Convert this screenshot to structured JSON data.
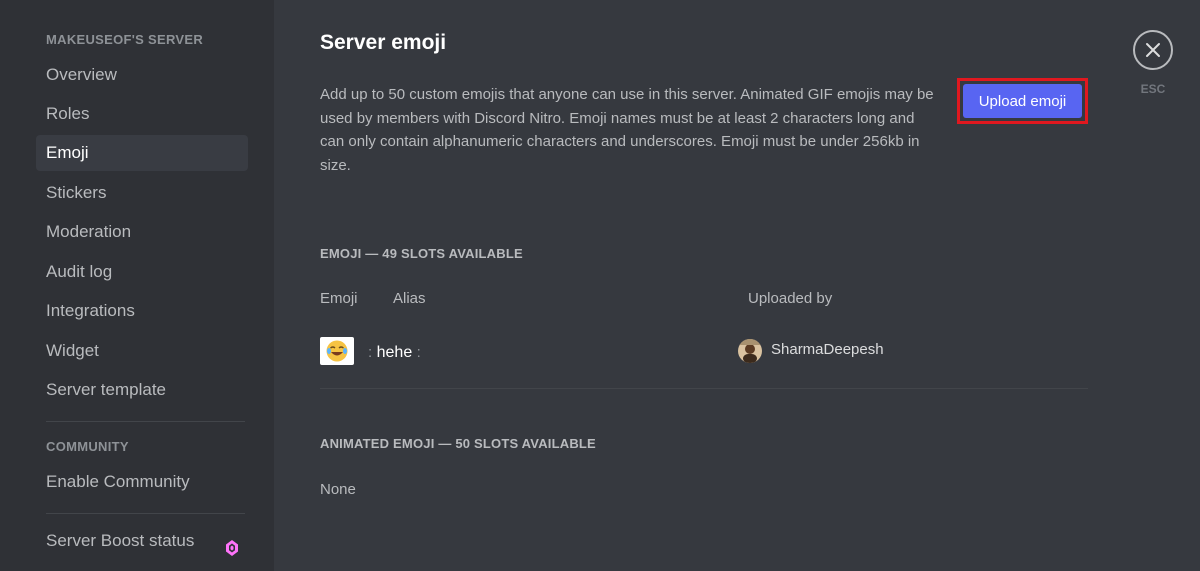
{
  "sidebar": {
    "server_header": "MAKEUSEOF'S SERVER",
    "items": [
      {
        "label": "Overview"
      },
      {
        "label": "Roles"
      },
      {
        "label": "Emoji"
      },
      {
        "label": "Stickers"
      },
      {
        "label": "Moderation"
      },
      {
        "label": "Audit log"
      },
      {
        "label": "Integrations"
      },
      {
        "label": "Widget"
      },
      {
        "label": "Server template"
      }
    ],
    "active_item": "Emoji",
    "community_header": "COMMUNITY",
    "community_items": [
      {
        "label": "Enable Community"
      }
    ],
    "boost_item": {
      "label": "Server Boost status",
      "icon": "boost-gem-icon"
    }
  },
  "main": {
    "title": "Server emoji",
    "description": "Add up to 50 custom emojis that anyone can use in this server. Animated GIF emojis may be used by members with Discord Nitro. Emoji names must be at least 2 characters long and can only contain alphanumeric characters and underscores. Emoji must be under 256kb in size.",
    "upload_button": "Upload emoji",
    "close_label": "ESC",
    "emoji_section": {
      "header": "EMOJI — 49 SLOTS AVAILABLE",
      "columns": [
        "Emoji",
        "Alias",
        "Uploaded by"
      ],
      "rows": [
        {
          "emoji_icon": "laughing-tears-emoji",
          "alias": "hehe",
          "colon": ":",
          "uploaded_by": "SharmaDeepesh"
        }
      ]
    },
    "animated_section": {
      "header": "ANIMATED EMOJI — 50 SLOTS AVAILABLE",
      "empty_text": "None"
    }
  },
  "colors": {
    "accent": "#5865f2",
    "highlight_border": "#e0181f",
    "sidebar_bg": "#2f3136",
    "main_bg": "#36393f",
    "boost_pink": "#ff73fa"
  }
}
